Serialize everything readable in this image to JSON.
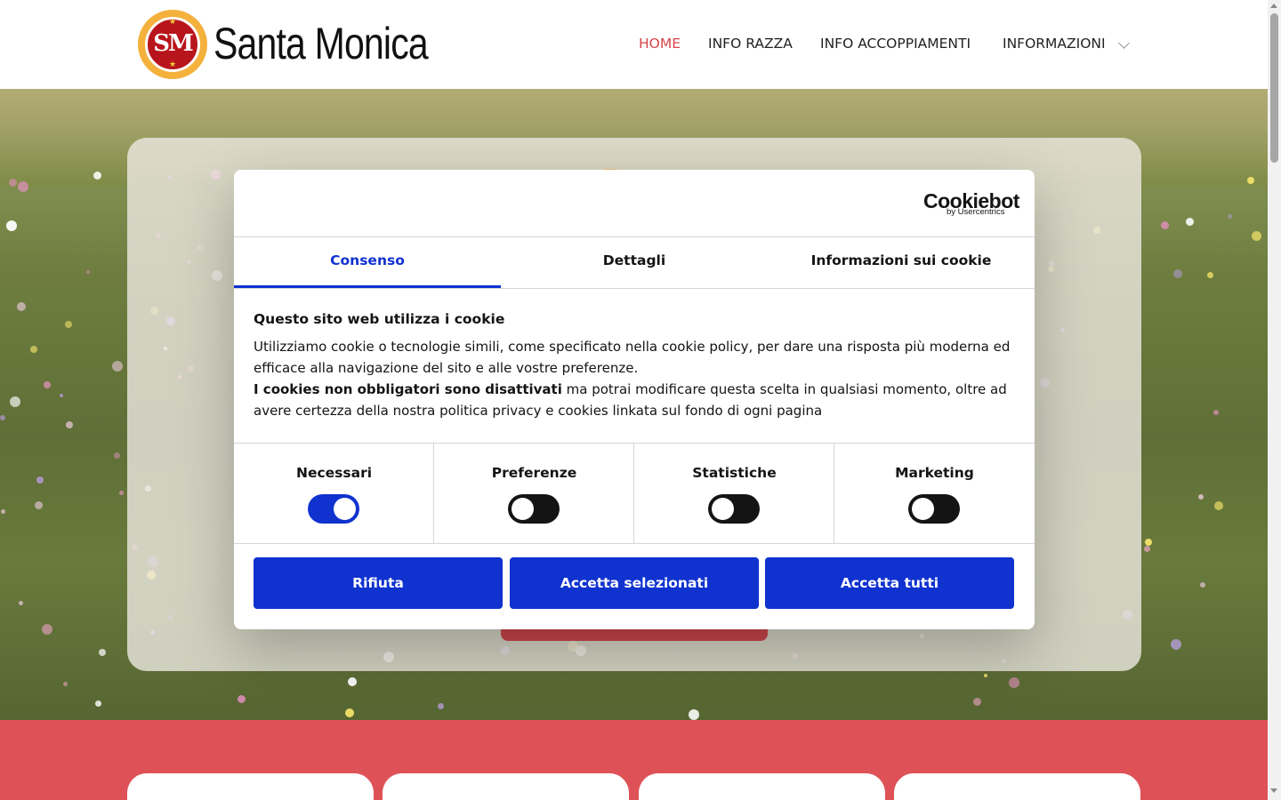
{
  "site": {
    "logo_text": "SM",
    "name": "Santa Monica"
  },
  "nav": {
    "items": [
      "HOME",
      "INFO RAZZA",
      "INFO ACCOPPIAMENTI",
      "INFORMAZIONI"
    ],
    "active": "HOME",
    "active_color": "#d7464b"
  },
  "cookie_dialog": {
    "brand": "Cookiebot",
    "brand_sub": "by Usercentrics",
    "tabs": [
      "Consenso",
      "Dettagli",
      "Informazioni sui cookie"
    ],
    "active_tab": "Consenso",
    "title": "Questo sito web utilizza i cookie",
    "body_text_1": "Utilizziamo cookie o tecnologie simili, come specificato nella cookie policy, per dare una risposta più moderna ed efficace alla navigazione del sito e alle vostre preferenze.",
    "body_bold": "I cookies non obbligatori sono disattivati",
    "body_text_2": " ma potrai modificare questa scelta in qualsiasi momento, oltre ad avere certezza della nostra politica privacy e cookies linkata sul fondo di ogni pagina",
    "toggles": [
      {
        "label": "Necessari",
        "on": true
      },
      {
        "label": "Preferenze",
        "on": false
      },
      {
        "label": "Statistiche",
        "on": false
      },
      {
        "label": "Marketing",
        "on": false
      }
    ],
    "buttons": [
      "Rifiuta",
      "Accetta selezionati",
      "Accetta tutti"
    ],
    "accent_color": "#1032cf"
  },
  "colors": {
    "section_red": "#de5257",
    "text_dark": "#141414"
  }
}
